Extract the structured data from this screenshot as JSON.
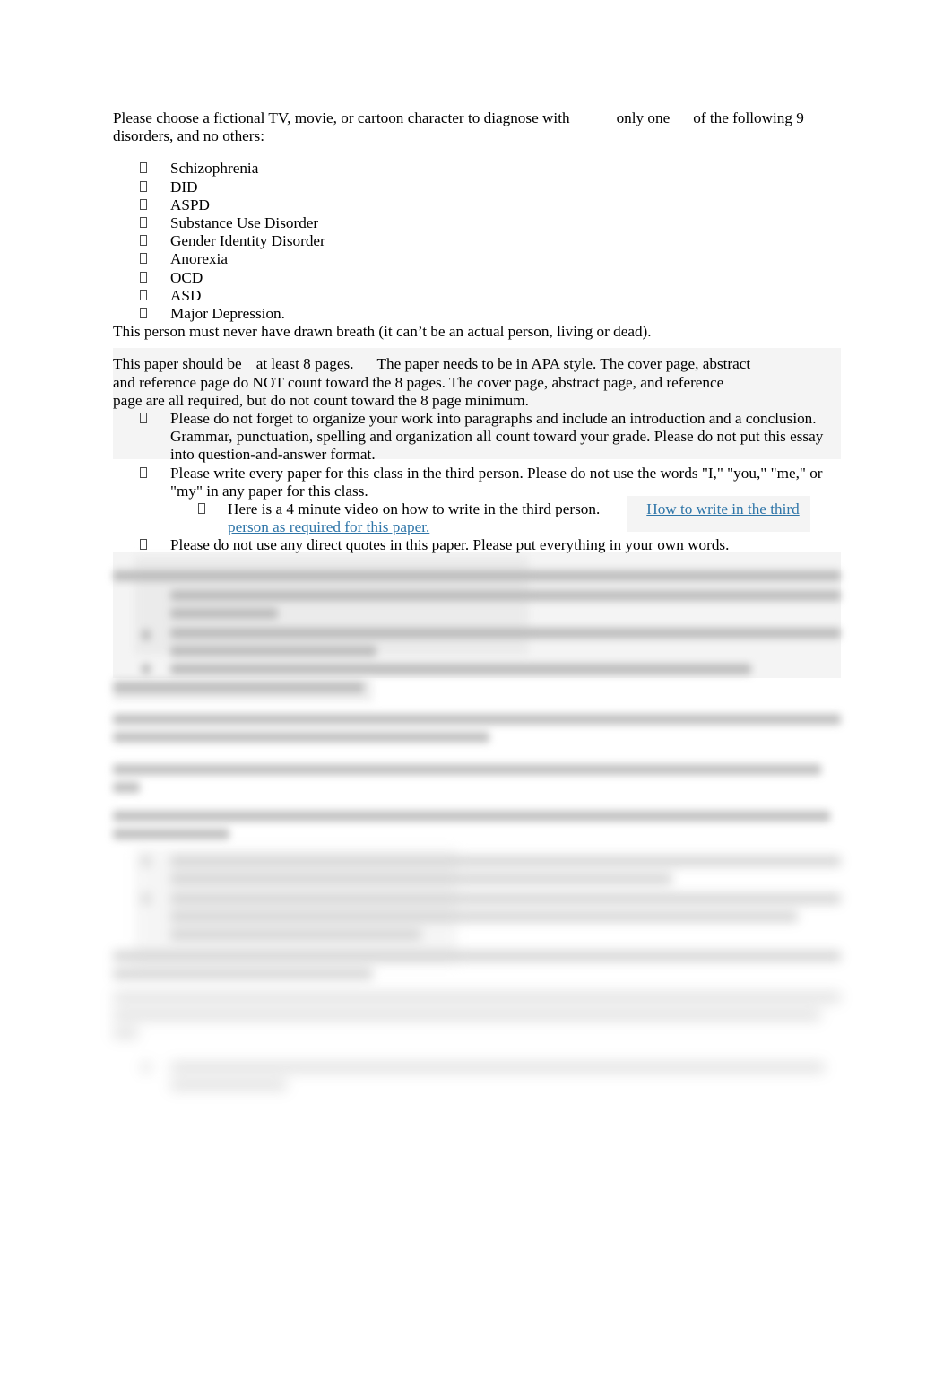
{
  "document": {
    "intro": {
      "text_before": "Please choose a fictional TV, movie, or cartoon character to diagnose with",
      "emphasis": "only one",
      "text_after": "of the following 9",
      "line2": "disorders, and no others:"
    },
    "disorders": [
      "Schizophrenia",
      "DID",
      "ASPD",
      "Substance Use Disorder",
      "Gender Identity Disorder",
      "Anorexia",
      "OCD",
      "ASD",
      "Major Depression."
    ],
    "fictional_note": "This person must never have drawn breath (it can’t be an actual person, living or dead).",
    "length_paragraph": {
      "part1": "This paper should be",
      "emphasis": "at least 8 pages.",
      "part2": "The paper needs to be in APA style. The cover page, abstract",
      "line2": "and reference page do NOT count toward the 8 pages. The cover page, abstract page, and reference",
      "line3": "page are all required, but do not count toward the 8 page minimum."
    },
    "requirements": [
      {
        "level": 1,
        "text": "Please do not forget to organize your work into paragraphs and include an introduction and a conclusion. Grammar, punctuation, spelling and organization all count toward your grade. Please do not put this essay into question-and-answer format."
      },
      {
        "level": 1,
        "text": "Please write every paper for this class in the third person. Please do not use the words \"I,\" \"you,\" \"me,\" or \"my\" in any paper for this class."
      },
      {
        "level": 2,
        "text": "Here is a 4 minute video on how to write in the third person.",
        "link_text": "How to write in the third person as required for this paper."
      },
      {
        "level": 1,
        "text": "Please do not use any direct quotes in this paper. Please put everything in your own words."
      }
    ],
    "redacted_note": "Remaining document content is blurred and illegible in the source image.",
    "colors": {
      "hyperlink": "#2e75a8",
      "highlight": "#f4f4f4",
      "text": "#000000"
    },
    "bullet_glyph": "missing-glyph-box"
  }
}
